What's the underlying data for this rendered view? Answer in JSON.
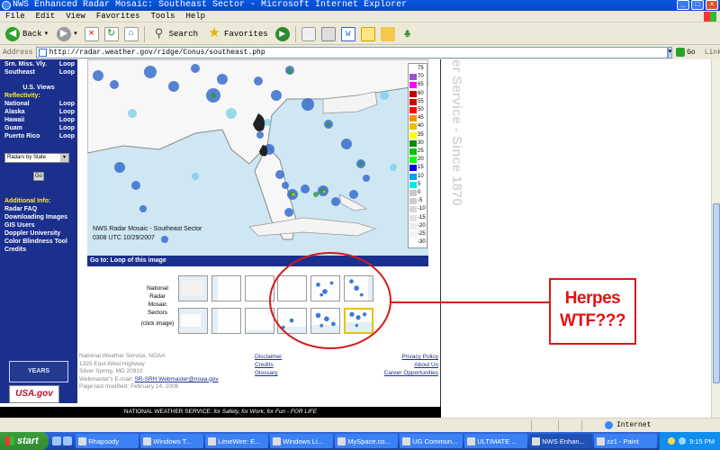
{
  "window": {
    "title": "NWS Enhanced Radar Mosaic: Southeast Sector - Microsoft Internet Explorer"
  },
  "menu": [
    "File",
    "Edit",
    "View",
    "Favorites",
    "Tools",
    "Help"
  ],
  "toolbar": {
    "back_label": "Back",
    "search_label": "Search",
    "favorites_label": "Favorites"
  },
  "address": {
    "label": "Address",
    "url": "http://radar.weather.gov/ridge/Conus/southeast.php",
    "go_label": "Go",
    "links_label": "Links"
  },
  "leftnav": {
    "rows_top": [
      {
        "name": "Srn. Miss. Vly.",
        "link": "Loop"
      },
      {
        "name": "Southeast",
        "link": "Loop"
      }
    ],
    "us_views_header": "U.S. Views",
    "reflectivity_label": "Reflectivity:",
    "rows_us": [
      {
        "name": "National",
        "link": "Loop"
      },
      {
        "name": "Alaska",
        "link": "Loop"
      },
      {
        "name": "Hawaii",
        "link": "Loop"
      },
      {
        "name": "Guam",
        "link": "Loop"
      },
      {
        "name": "Puerto Rico",
        "link": "Loop"
      }
    ],
    "select_value": "Radars by State",
    "go_button": "Go",
    "additional_info_label": "Additional Info:",
    "info_links": [
      "Radar FAQ",
      "Downloading Images",
      "GIS Users",
      "Doppler University",
      "Color Blindness Tool",
      "Credits"
    ],
    "badge_100": "YEARS",
    "badge_usagov": "USA.gov"
  },
  "radar": {
    "caption_line1": "NWS Radar Mosaic - Southeast Sector",
    "caption_line2": "0308 UTC 10/29/2007",
    "goto_text": "Go to: Loop of this image",
    "legend": [
      {
        "label": "75",
        "color": "#ffffff"
      },
      {
        "label": "70",
        "color": "#9955c9"
      },
      {
        "label": "65",
        "color": "#ff00ff"
      },
      {
        "label": "60",
        "color": "#c00000"
      },
      {
        "label": "55",
        "color": "#d00000"
      },
      {
        "label": "50",
        "color": "#ff0000"
      },
      {
        "label": "45",
        "color": "#ff9000"
      },
      {
        "label": "40",
        "color": "#e7c000"
      },
      {
        "label": "35",
        "color": "#ffff00"
      },
      {
        "label": "30",
        "color": "#008e00"
      },
      {
        "label": "25",
        "color": "#01c501"
      },
      {
        "label": "20",
        "color": "#02fd02"
      },
      {
        "label": "15",
        "color": "#0300f4"
      },
      {
        "label": "10",
        "color": "#019ff4"
      },
      {
        "label": "5",
        "color": "#04e9e7"
      },
      {
        "label": "0",
        "color": "#c8c8c8"
      },
      {
        "label": "-5",
        "color": "#cccccc"
      },
      {
        "label": "-10",
        "color": "#d8d8d8"
      },
      {
        "label": "-15",
        "color": "#e2e2e2"
      },
      {
        "label": "-20",
        "color": "#ececec"
      },
      {
        "label": "-25",
        "color": "#f4f4f4"
      },
      {
        "label": "-30",
        "color": "#ffffff"
      }
    ]
  },
  "sectors": {
    "label_lines": [
      "National",
      "Radar",
      "Mosaic",
      "Sectors"
    ],
    "click_label": "(click image)"
  },
  "footer": {
    "nws_lines": [
      "National Weather Service, NOAA",
      "1325 East-West Highway",
      "Silver Spring, MD 20910"
    ],
    "webmaster_label": "Webmaster's E-mail:",
    "webmaster_email": "SR-SRH.Webmaster@noaa.gov",
    "last_modified": "Page last modified: February 14, 2006",
    "mid_links": [
      "Disclaimer",
      "Credits",
      "Glossary"
    ],
    "right_links": [
      "Privacy Policy",
      "About Us",
      "Career Opportunities"
    ],
    "bottom_bar_lead": "NATIONAL WEATHER SERVICE:",
    "bottom_bar_tail": "for Safety, for Work, for Fun - FOR LIFE"
  },
  "watermark": "er Service - Since 1870",
  "annotation": {
    "line1": "Herpes",
    "line2": "WTF???",
    "color": "#e21212"
  },
  "status": {
    "zone": "Internet"
  },
  "taskbar": {
    "start_label": "start",
    "tasks": [
      {
        "label": "Rhapsody",
        "active": false
      },
      {
        "label": "Windows T...",
        "active": false
      },
      {
        "label": "LimeWire: E...",
        "active": false
      },
      {
        "label": "Windows Li...",
        "active": false
      },
      {
        "label": "MySpace.co...",
        "active": false
      },
      {
        "label": "UG Commun...",
        "active": false
      },
      {
        "label": "ULTIMATE ...",
        "active": false
      },
      {
        "label": "NWS Enhan...",
        "active": true
      },
      {
        "label": "zz1 - Paint",
        "active": false
      }
    ],
    "clock": "9:15 PM"
  }
}
